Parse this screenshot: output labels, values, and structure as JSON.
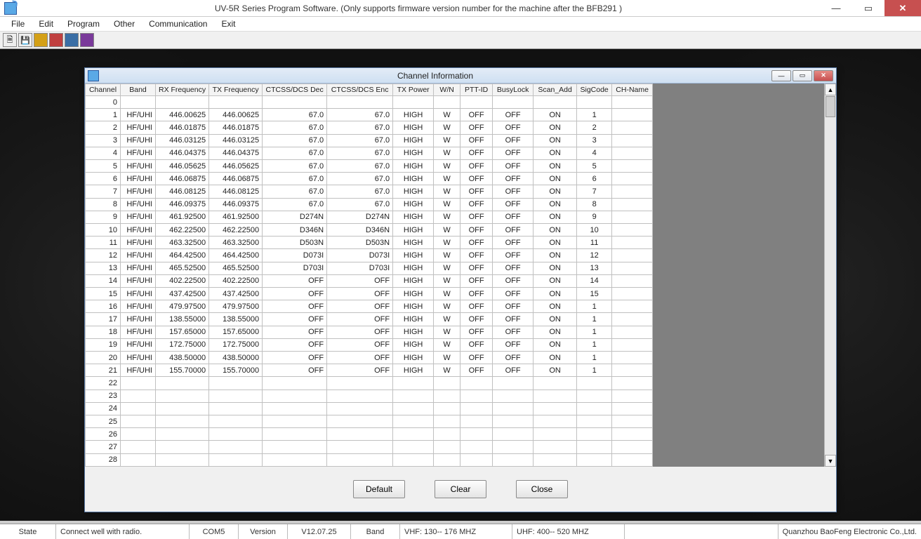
{
  "window": {
    "title": "UV-5R Series Program Software. (Only supports firmware version number for the machine after the BFB291 )"
  },
  "menu": {
    "items": [
      "File",
      "Edit",
      "Program",
      "Other",
      "Communication",
      "Exit"
    ]
  },
  "child": {
    "title": "Channel Information",
    "buttons": {
      "default": "Default",
      "clear": "Clear",
      "close": "Close"
    }
  },
  "columns": [
    "Channel",
    "Band",
    "RX Frequency",
    "TX Frequency",
    "CTCSS/DCS Dec",
    "CTCSS/DCS Enc",
    "TX Power",
    "W/N",
    "PTT-ID",
    "BusyLock",
    "Scan_Add",
    "SigCode",
    "CH-Name"
  ],
  "rows": [
    {
      "ch": "0"
    },
    {
      "ch": "1",
      "band": "HF/UHI",
      "rx": "446.00625",
      "tx": "446.00625",
      "dec": "67.0",
      "enc": "67.0",
      "pwr": "HIGH",
      "wn": "W",
      "ptt": "OFF",
      "busy": "OFF",
      "scan": "ON",
      "sig": "1",
      "name": ""
    },
    {
      "ch": "2",
      "band": "HF/UHI",
      "rx": "446.01875",
      "tx": "446.01875",
      "dec": "67.0",
      "enc": "67.0",
      "pwr": "HIGH",
      "wn": "W",
      "ptt": "OFF",
      "busy": "OFF",
      "scan": "ON",
      "sig": "2",
      "name": ""
    },
    {
      "ch": "3",
      "band": "HF/UHI",
      "rx": "446.03125",
      "tx": "446.03125",
      "dec": "67.0",
      "enc": "67.0",
      "pwr": "HIGH",
      "wn": "W",
      "ptt": "OFF",
      "busy": "OFF",
      "scan": "ON",
      "sig": "3",
      "name": ""
    },
    {
      "ch": "4",
      "band": "HF/UHI",
      "rx": "446.04375",
      "tx": "446.04375",
      "dec": "67.0",
      "enc": "67.0",
      "pwr": "HIGH",
      "wn": "W",
      "ptt": "OFF",
      "busy": "OFF",
      "scan": "ON",
      "sig": "4",
      "name": ""
    },
    {
      "ch": "5",
      "band": "HF/UHI",
      "rx": "446.05625",
      "tx": "446.05625",
      "dec": "67.0",
      "enc": "67.0",
      "pwr": "HIGH",
      "wn": "W",
      "ptt": "OFF",
      "busy": "OFF",
      "scan": "ON",
      "sig": "5",
      "name": ""
    },
    {
      "ch": "6",
      "band": "HF/UHI",
      "rx": "446.06875",
      "tx": "446.06875",
      "dec": "67.0",
      "enc": "67.0",
      "pwr": "HIGH",
      "wn": "W",
      "ptt": "OFF",
      "busy": "OFF",
      "scan": "ON",
      "sig": "6",
      "name": ""
    },
    {
      "ch": "7",
      "band": "HF/UHI",
      "rx": "446.08125",
      "tx": "446.08125",
      "dec": "67.0",
      "enc": "67.0",
      "pwr": "HIGH",
      "wn": "W",
      "ptt": "OFF",
      "busy": "OFF",
      "scan": "ON",
      "sig": "7",
      "name": ""
    },
    {
      "ch": "8",
      "band": "HF/UHI",
      "rx": "446.09375",
      "tx": "446.09375",
      "dec": "67.0",
      "enc": "67.0",
      "pwr": "HIGH",
      "wn": "W",
      "ptt": "OFF",
      "busy": "OFF",
      "scan": "ON",
      "sig": "8",
      "name": ""
    },
    {
      "ch": "9",
      "band": "HF/UHI",
      "rx": "461.92500",
      "tx": "461.92500",
      "dec": "D274N",
      "enc": "D274N",
      "pwr": "HIGH",
      "wn": "W",
      "ptt": "OFF",
      "busy": "OFF",
      "scan": "ON",
      "sig": "9",
      "name": ""
    },
    {
      "ch": "10",
      "band": "HF/UHI",
      "rx": "462.22500",
      "tx": "462.22500",
      "dec": "D346N",
      "enc": "D346N",
      "pwr": "HIGH",
      "wn": "W",
      "ptt": "OFF",
      "busy": "OFF",
      "scan": "ON",
      "sig": "10",
      "name": ""
    },
    {
      "ch": "11",
      "band": "HF/UHI",
      "rx": "463.32500",
      "tx": "463.32500",
      "dec": "D503N",
      "enc": "D503N",
      "pwr": "HIGH",
      "wn": "W",
      "ptt": "OFF",
      "busy": "OFF",
      "scan": "ON",
      "sig": "11",
      "name": ""
    },
    {
      "ch": "12",
      "band": "HF/UHI",
      "rx": "464.42500",
      "tx": "464.42500",
      "dec": "D073I",
      "enc": "D073I",
      "pwr": "HIGH",
      "wn": "W",
      "ptt": "OFF",
      "busy": "OFF",
      "scan": "ON",
      "sig": "12",
      "name": ""
    },
    {
      "ch": "13",
      "band": "HF/UHI",
      "rx": "465.52500",
      "tx": "465.52500",
      "dec": "D703I",
      "enc": "D703I",
      "pwr": "HIGH",
      "wn": "W",
      "ptt": "OFF",
      "busy": "OFF",
      "scan": "ON",
      "sig": "13",
      "name": ""
    },
    {
      "ch": "14",
      "band": "HF/UHI",
      "rx": "402.22500",
      "tx": "402.22500",
      "dec": "OFF",
      "enc": "OFF",
      "pwr": "HIGH",
      "wn": "W",
      "ptt": "OFF",
      "busy": "OFF",
      "scan": "ON",
      "sig": "14",
      "name": ""
    },
    {
      "ch": "15",
      "band": "HF/UHI",
      "rx": "437.42500",
      "tx": "437.42500",
      "dec": "OFF",
      "enc": "OFF",
      "pwr": "HIGH",
      "wn": "W",
      "ptt": "OFF",
      "busy": "OFF",
      "scan": "ON",
      "sig": "15",
      "name": ""
    },
    {
      "ch": "16",
      "band": "HF/UHI",
      "rx": "479.97500",
      "tx": "479.97500",
      "dec": "OFF",
      "enc": "OFF",
      "pwr": "HIGH",
      "wn": "W",
      "ptt": "OFF",
      "busy": "OFF",
      "scan": "ON",
      "sig": "1",
      "name": ""
    },
    {
      "ch": "17",
      "band": "HF/UHI",
      "rx": "138.55000",
      "tx": "138.55000",
      "dec": "OFF",
      "enc": "OFF",
      "pwr": "HIGH",
      "wn": "W",
      "ptt": "OFF",
      "busy": "OFF",
      "scan": "ON",
      "sig": "1",
      "name": ""
    },
    {
      "ch": "18",
      "band": "HF/UHI",
      "rx": "157.65000",
      "tx": "157.65000",
      "dec": "OFF",
      "enc": "OFF",
      "pwr": "HIGH",
      "wn": "W",
      "ptt": "OFF",
      "busy": "OFF",
      "scan": "ON",
      "sig": "1",
      "name": ""
    },
    {
      "ch": "19",
      "band": "HF/UHI",
      "rx": "172.75000",
      "tx": "172.75000",
      "dec": "OFF",
      "enc": "OFF",
      "pwr": "HIGH",
      "wn": "W",
      "ptt": "OFF",
      "busy": "OFF",
      "scan": "ON",
      "sig": "1",
      "name": ""
    },
    {
      "ch": "20",
      "band": "HF/UHI",
      "rx": "438.50000",
      "tx": "438.50000",
      "dec": "OFF",
      "enc": "OFF",
      "pwr": "HIGH",
      "wn": "W",
      "ptt": "OFF",
      "busy": "OFF",
      "scan": "ON",
      "sig": "1",
      "name": ""
    },
    {
      "ch": "21",
      "band": "HF/UHI",
      "rx": "155.70000",
      "tx": "155.70000",
      "dec": "OFF",
      "enc": "OFF",
      "pwr": "HIGH",
      "wn": "W",
      "ptt": "OFF",
      "busy": "OFF",
      "scan": "ON",
      "sig": "1",
      "name": ""
    },
    {
      "ch": "22"
    },
    {
      "ch": "23"
    },
    {
      "ch": "24"
    },
    {
      "ch": "25"
    },
    {
      "ch": "26"
    },
    {
      "ch": "27"
    },
    {
      "ch": "28"
    }
  ],
  "status": {
    "state_label": "State",
    "state_value": "Connect well with radio.",
    "com": "COM5",
    "version_label": "Version",
    "version_value": "V12.07.25",
    "band_label": "Band",
    "vhf": "VHF: 130-- 176 MHZ",
    "uhf": "UHF: 400-- 520 MHZ",
    "vendor": "Quanzhou BaoFeng Electronic Co.,Ltd."
  }
}
